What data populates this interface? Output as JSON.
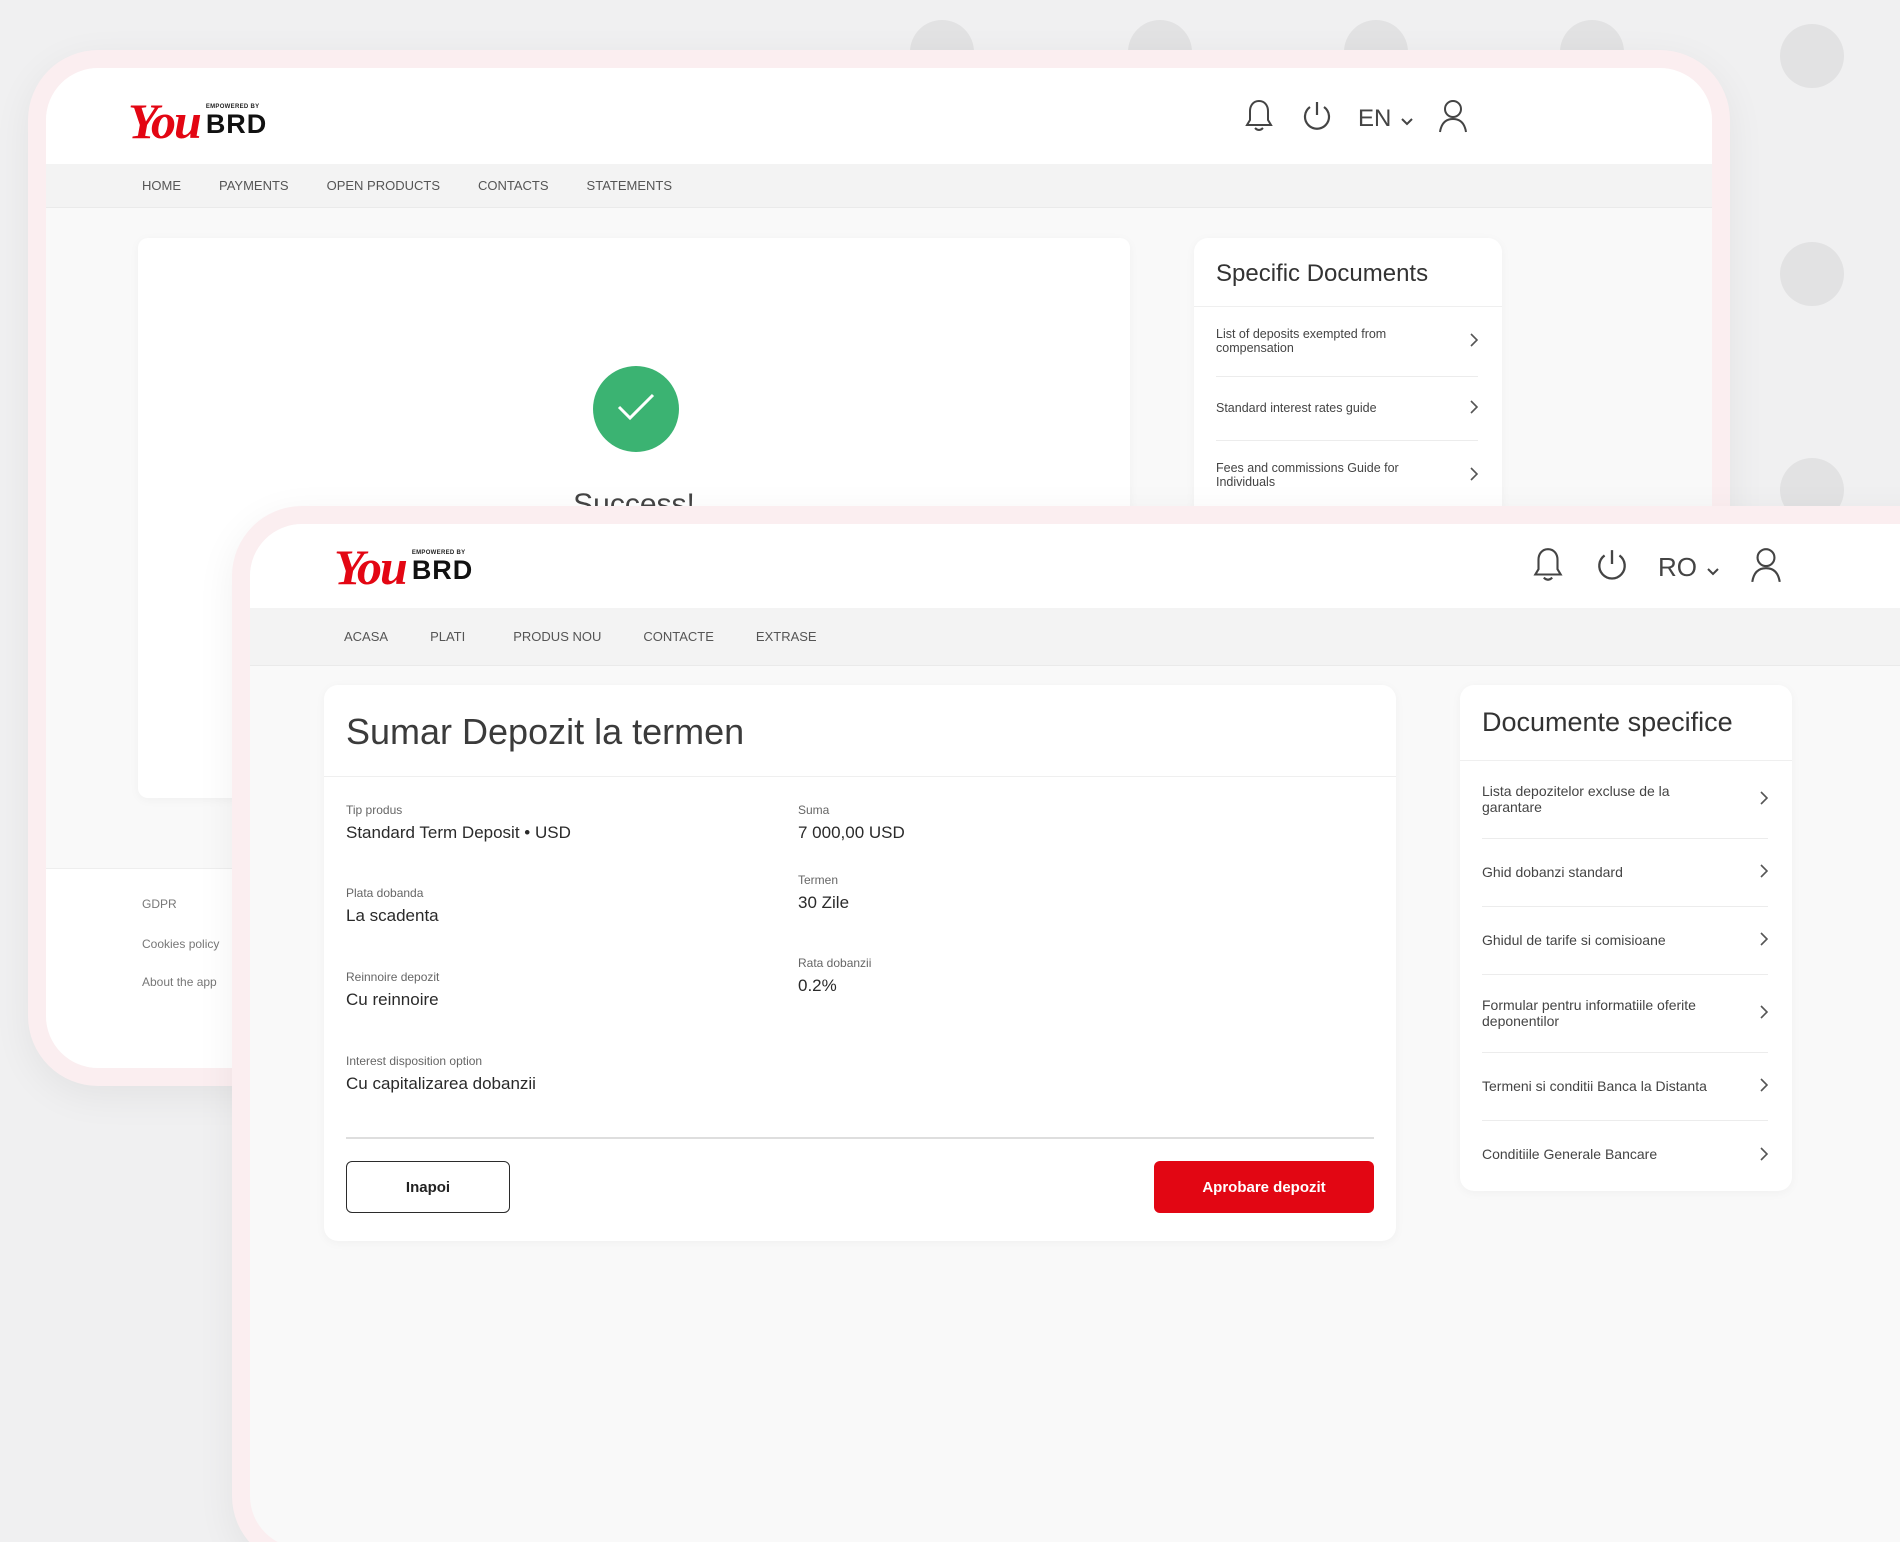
{
  "back_screen": {
    "logo": {
      "you": "You",
      "empowered": "EMPOWERED BY",
      "brd": "BRD"
    },
    "language": "EN",
    "nav": [
      "HOME",
      "PAYMENTS",
      "OPEN PRODUCTS",
      "CONTACTS",
      "STATEMENTS"
    ],
    "success_text": "Success!",
    "docs": {
      "title": "Specific Documents",
      "items": [
        "List of deposits exempted from compensation",
        "Standard interest rates guide",
        "Fees and commissions Guide for Individuals"
      ]
    },
    "footer": [
      "GDPR",
      "Cookies policy",
      "About the app"
    ]
  },
  "front_screen": {
    "logo": {
      "you": "You",
      "empowered": "EMPOWERED BY",
      "brd": "BRD"
    },
    "language": "RO",
    "nav": [
      "ACASA",
      "PLATI",
      "PRODUS NOU",
      "CONTACTE",
      "EXTRASE"
    ],
    "summary": {
      "title": "Sumar Depozit la termen",
      "product_type": {
        "label": "Tip produs",
        "value": "Standard Term Deposit • USD"
      },
      "interest_payment": {
        "label": "Plata dobanda",
        "value": "La scadenta"
      },
      "renewal": {
        "label": "Reinnoire depozit",
        "value": "Cu reinnoire"
      },
      "interest_disposition": {
        "label": "Interest disposition option",
        "value": "Cu capitalizarea dobanzii"
      },
      "amount": {
        "label": "Suma",
        "value": "7 000,00 USD"
      },
      "term": {
        "label": "Termen",
        "value": "30 Zile"
      },
      "interest_rate": {
        "label": "Rata dobanzii",
        "value": "0.2%"
      },
      "back_button": "Inapoi",
      "approve_button": "Aprobare depozit"
    },
    "docs": {
      "title": "Documente specifice",
      "items": [
        "Lista depozitelor excluse de la garantare",
        "Ghid dobanzi standard",
        "Ghidul de tarife si comisioane",
        "Formular pentru informatiile oferite deponentilor",
        "Termeni si conditii Banca la Distanta",
        "Conditiile Generale Bancare"
      ]
    }
  },
  "colors": {
    "brand_red": "#e30613",
    "success_green": "#3bb372",
    "device_frame": "#fbeef0"
  },
  "icons": [
    "bell-icon",
    "power-icon",
    "chevron-down-icon",
    "user-icon",
    "checkmark-icon",
    "chevron-right-icon"
  ]
}
